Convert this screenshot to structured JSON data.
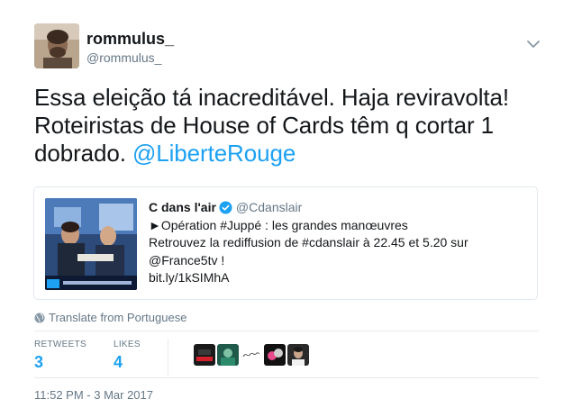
{
  "author": {
    "display_name": "rommulus_",
    "handle": "@rommulus_"
  },
  "tweet": {
    "text_line1": "Essa eleição tá inacreditável. Haja reviravolta!",
    "text_line2": "Roteiristas de House of Cards têm q cortar 1",
    "text_line3_prefix": "dobrado. ",
    "mention": "@LiberteRouge"
  },
  "quoted_tweet": {
    "name": "C dans l'air",
    "handle": "@Cdanslair",
    "line1": "►Opération #Juppé : les grandes manœuvres",
    "line2": "Retrouvez la rediffusion de #cdanslair à 22.45 et 5.20 sur",
    "line3": "@France5tv !",
    "line4": "bit.ly/1kSIMhA"
  },
  "translate_label": "Translate from Portuguese",
  "stats": {
    "retweets_label": "RETWEETS",
    "retweets_value": "3",
    "likes_label": "LIKES",
    "likes_value": "4"
  },
  "timestamp": "11:52 PM - 3 Mar 2017",
  "colors": {
    "link": "#1da1f2",
    "secondary_text": "#657786",
    "border": "#e1e8ed"
  },
  "icons": {
    "caret": "chevron-down-icon",
    "verified": "verified-badge-icon",
    "translate": "globe-icon"
  }
}
